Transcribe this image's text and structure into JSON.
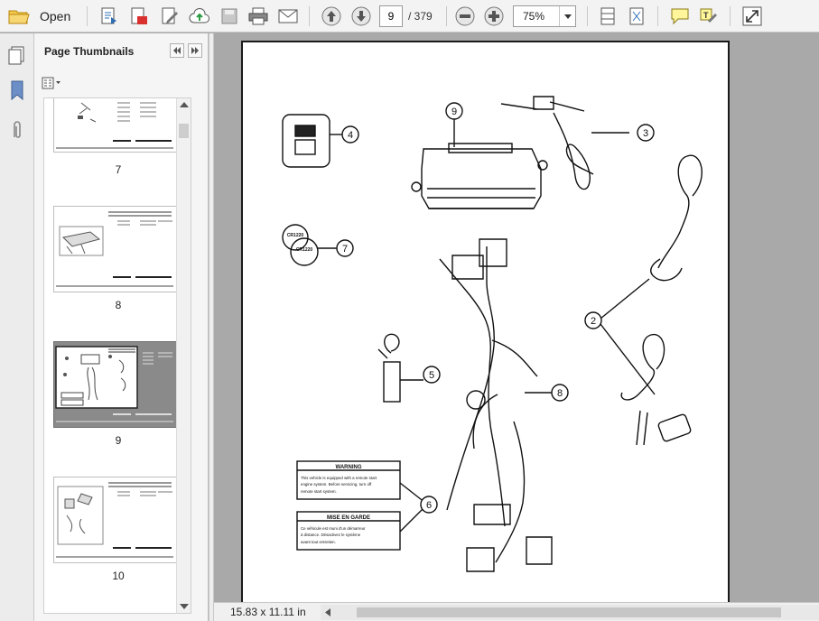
{
  "toolbar": {
    "open_label": "Open",
    "current_page": "9",
    "total_pages": "/ 379",
    "zoom": "75%",
    "buttons": [
      "open-folder-icon",
      "create-icon",
      "pdf-icon",
      "edit-icon",
      "upload-icon",
      "save-icon",
      "print-icon",
      "email-icon",
      "previous-page-icon",
      "next-page-icon",
      "zoom-out-icon",
      "zoom-in-icon",
      "fit-width-icon",
      "fit-page-icon",
      "comment-icon",
      "highlight-icon",
      "expand-icon"
    ]
  },
  "sidebar": {
    "title": "Page Thumbnails",
    "thumbnails": [
      {
        "label": "7"
      },
      {
        "label": "8"
      },
      {
        "label": "9",
        "selected": true
      },
      {
        "label": "10"
      }
    ]
  },
  "status": {
    "page_size": "15.83 x 11.11 in"
  },
  "drawing": {
    "callouts": [
      "9",
      "4",
      "3",
      "7",
      "2",
      "5",
      "8",
      "6"
    ],
    "labels": {
      "warning_title": "WARNING",
      "warning_line1": "This vehicle is equipped with a remote start",
      "warning_line2": "engine system. Before servicing, turn off",
      "warning_line3": "remote start system.",
      "caution_title": "MISE EN GARDE",
      "caution_line1": "Ce véhicule est muni d'un démarreur",
      "caution_line2": "à distance. Désactivez le système",
      "caution_line3": "avant tout entretien.",
      "coin1": "CR1220",
      "coin2": "CR1220"
    }
  }
}
